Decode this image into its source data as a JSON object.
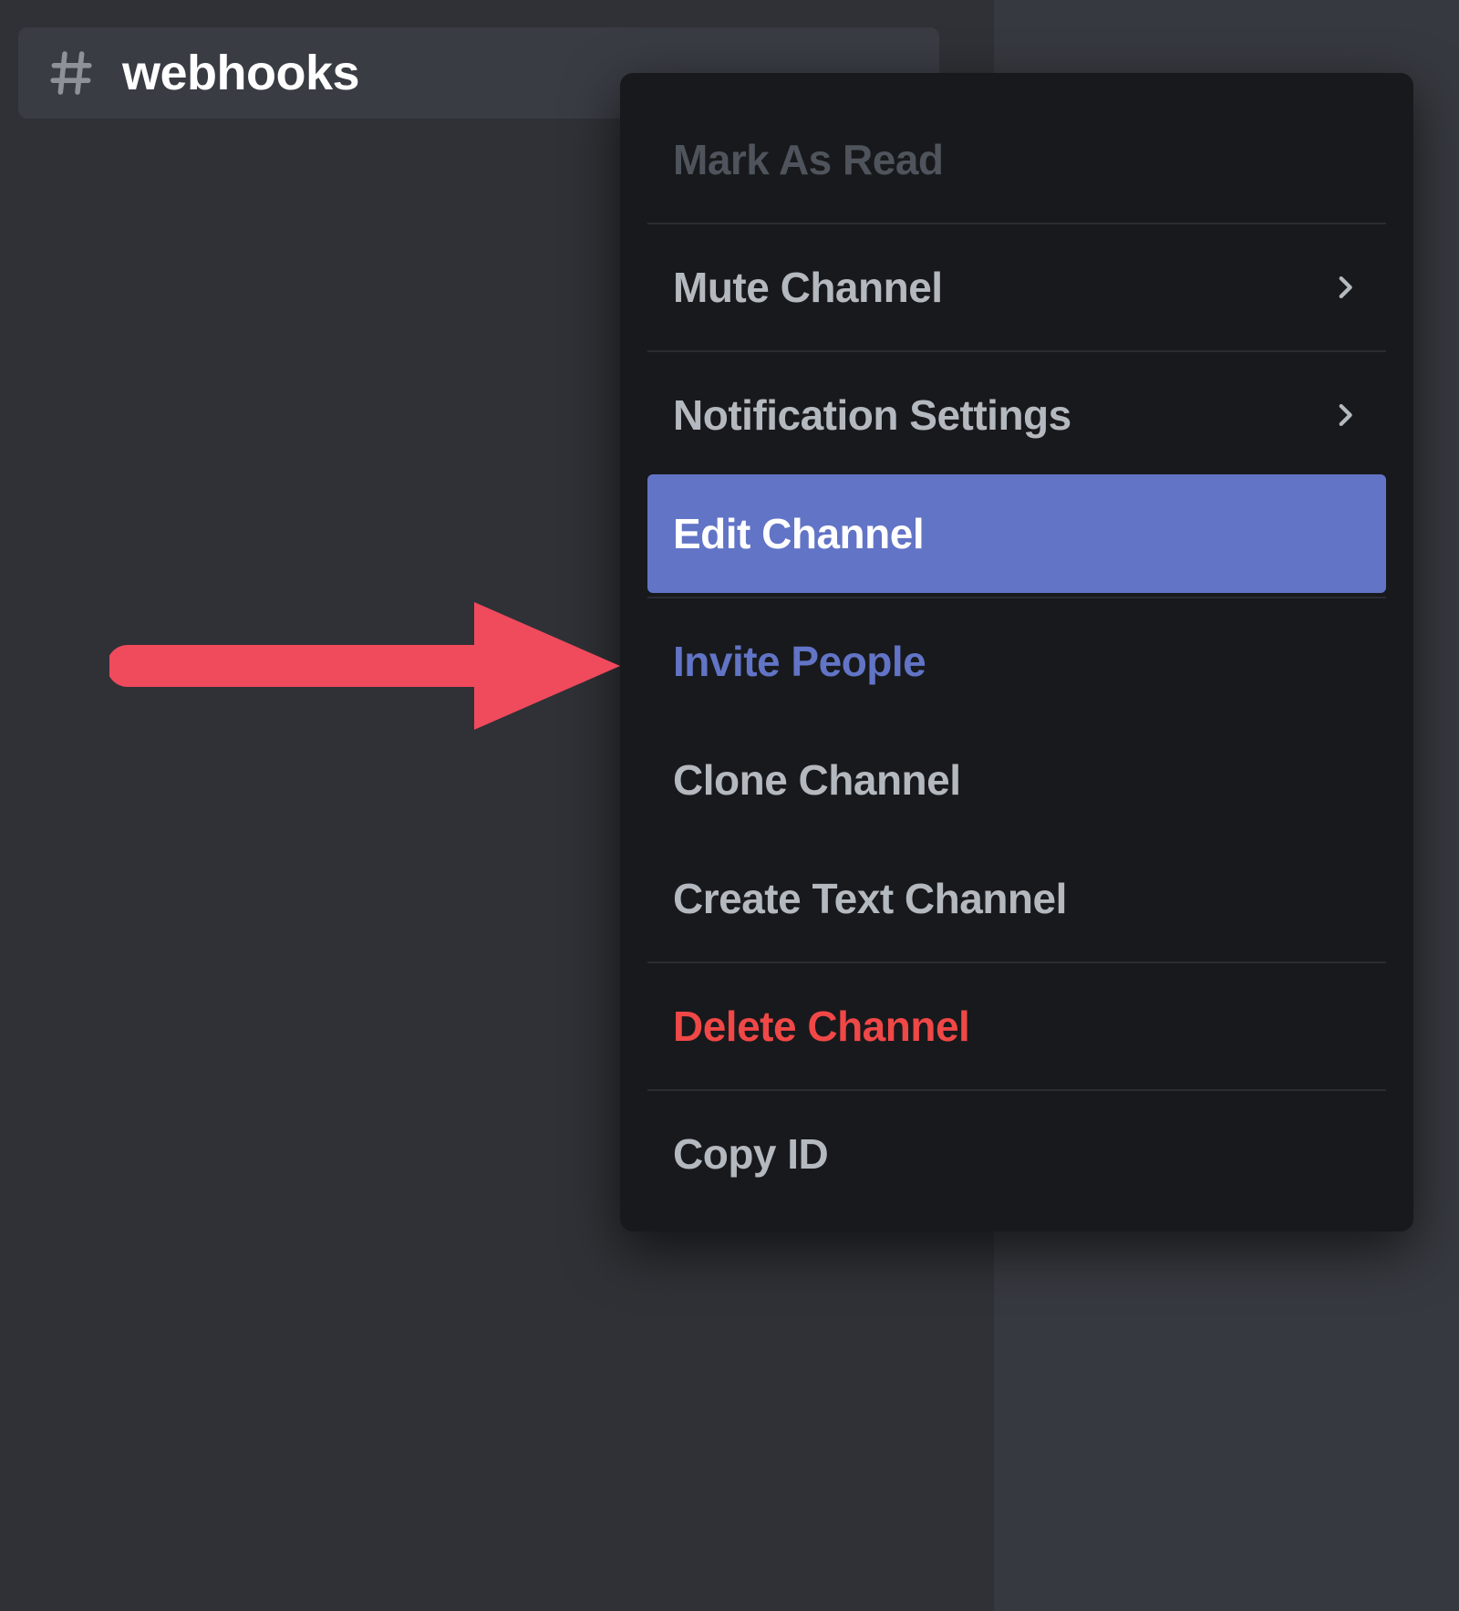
{
  "channel": {
    "name": "webhooks"
  },
  "menu": {
    "mark_as_read": "Mark As Read",
    "mute_channel": "Mute Channel",
    "notification_settings": "Notification Settings",
    "edit_channel": "Edit Channel",
    "invite_people": "Invite People",
    "clone_channel": "Clone Channel",
    "create_text_channel": "Create Text Channel",
    "delete_channel": "Delete Channel",
    "copy_id": "Copy ID"
  },
  "annotation": {
    "arrow_color": "#f04a5d"
  }
}
